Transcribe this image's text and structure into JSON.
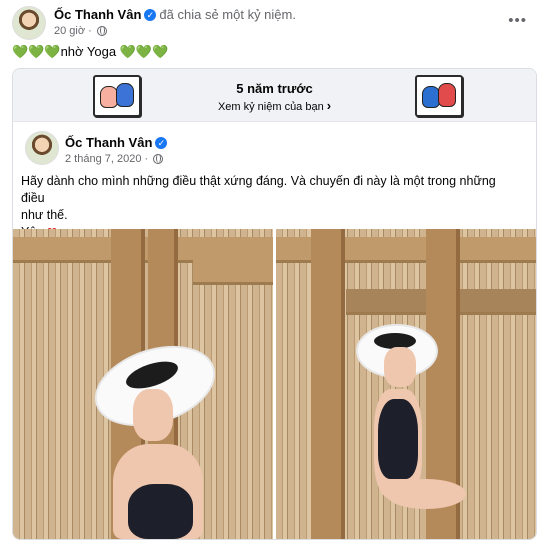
{
  "post": {
    "author": "Ốc Thanh Vân",
    "action": "đã chia sẻ một kỷ niệm.",
    "time": "20 giờ",
    "caption_hearts_left": "💚💚💚",
    "caption_text": "nhờ Yoga",
    "caption_hearts_right": "💚💚💚",
    "more_icon": "•••"
  },
  "memory": {
    "title": "5 năm trước",
    "link_label": "Xem kỷ niệm của bạn",
    "chevron": "›"
  },
  "original_post": {
    "author": "Ốc Thanh Vân",
    "date": "2 tháng 7, 2020",
    "text_line1": "Hãy dành cho mình những điều thật xứng đáng. Và chuyến đi này là một trong những điều",
    "text_line2": "như thế.",
    "text_line3": "Yêu.",
    "heart": "❤"
  },
  "icons": {
    "verified": "✓",
    "audience": "globe-icon"
  },
  "colors": {
    "verified_blue": "#1877f2",
    "meta_gray": "#65676b",
    "heart_red": "#e8222f",
    "banner_bg": "#f0f2f5"
  }
}
